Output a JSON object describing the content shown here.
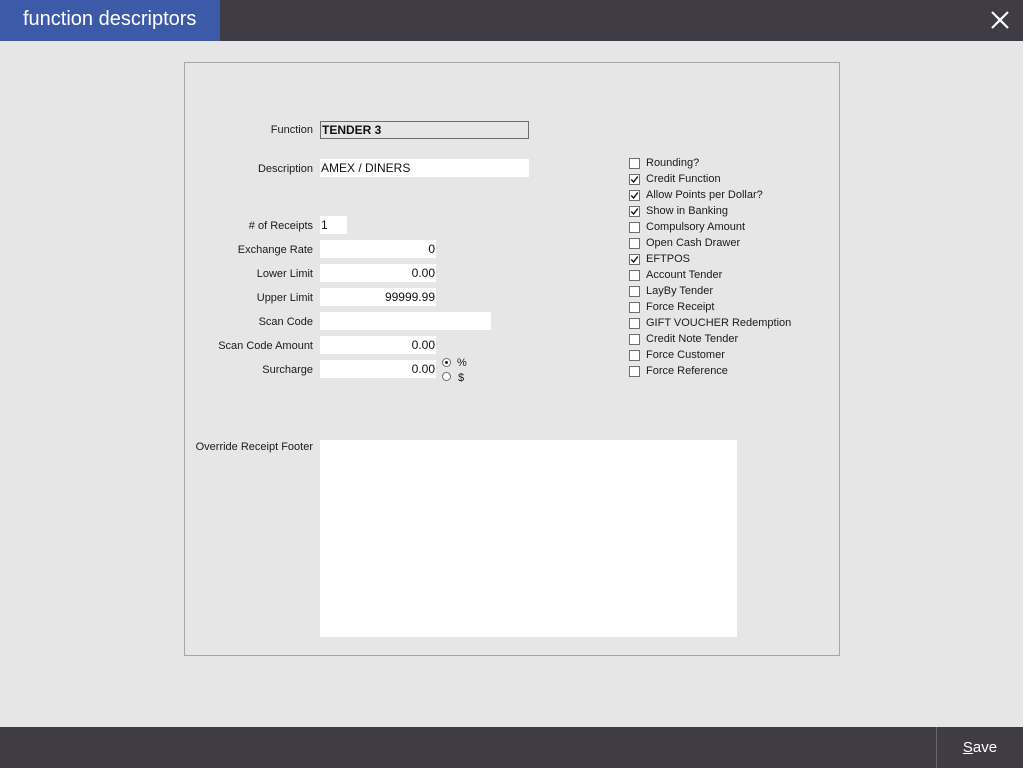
{
  "window": {
    "title": "function descriptors",
    "close_icon": "close-icon"
  },
  "form": {
    "function_label": "Function",
    "function_value": "TENDER 3",
    "description_label": "Description",
    "description_value": "AMEX / DINERS",
    "receipts_label": "# of Receipts",
    "receipts_value": "1",
    "exchange_rate_label": "Exchange Rate",
    "exchange_rate_value": "0",
    "lower_limit_label": "Lower Limit",
    "lower_limit_value": "0.00",
    "upper_limit_label": "Upper Limit",
    "upper_limit_value": "99999.99",
    "scan_code_label": "Scan Code",
    "scan_code_value": "",
    "scan_code_amount_label": "Scan Code Amount",
    "scan_code_amount_value": "0.00",
    "surcharge_label": "Surcharge",
    "surcharge_value": "0.00",
    "surcharge_type": {
      "percent_label": "%",
      "dollar_label": "$",
      "selected": "%"
    },
    "override_footer_label": "Override Receipt Footer",
    "override_footer_value": ""
  },
  "options": [
    {
      "label": "Rounding?",
      "checked": false
    },
    {
      "label": "Credit Function",
      "checked": true
    },
    {
      "label": "Allow Points per Dollar?",
      "checked": true
    },
    {
      "label": "Show in Banking",
      "checked": true
    },
    {
      "label": "Compulsory Amount",
      "checked": false
    },
    {
      "label": "Open Cash Drawer",
      "checked": false
    },
    {
      "label": "EFTPOS",
      "checked": true
    },
    {
      "label": "Account Tender",
      "checked": false
    },
    {
      "label": "LayBy Tender",
      "checked": false
    },
    {
      "label": "Force Receipt",
      "checked": false
    },
    {
      "label": "GIFT VOUCHER Redemption",
      "checked": false
    },
    {
      "label": "Credit Note Tender",
      "checked": false
    },
    {
      "label": "Force Customer",
      "checked": false
    },
    {
      "label": "Force Reference",
      "checked": false
    }
  ],
  "footer": {
    "save_hotkey": "S",
    "save_rest": "ave"
  },
  "colors": {
    "titlebar": "#403c46",
    "title_tab": "#3d5aa8",
    "background": "#e6e6e6"
  }
}
